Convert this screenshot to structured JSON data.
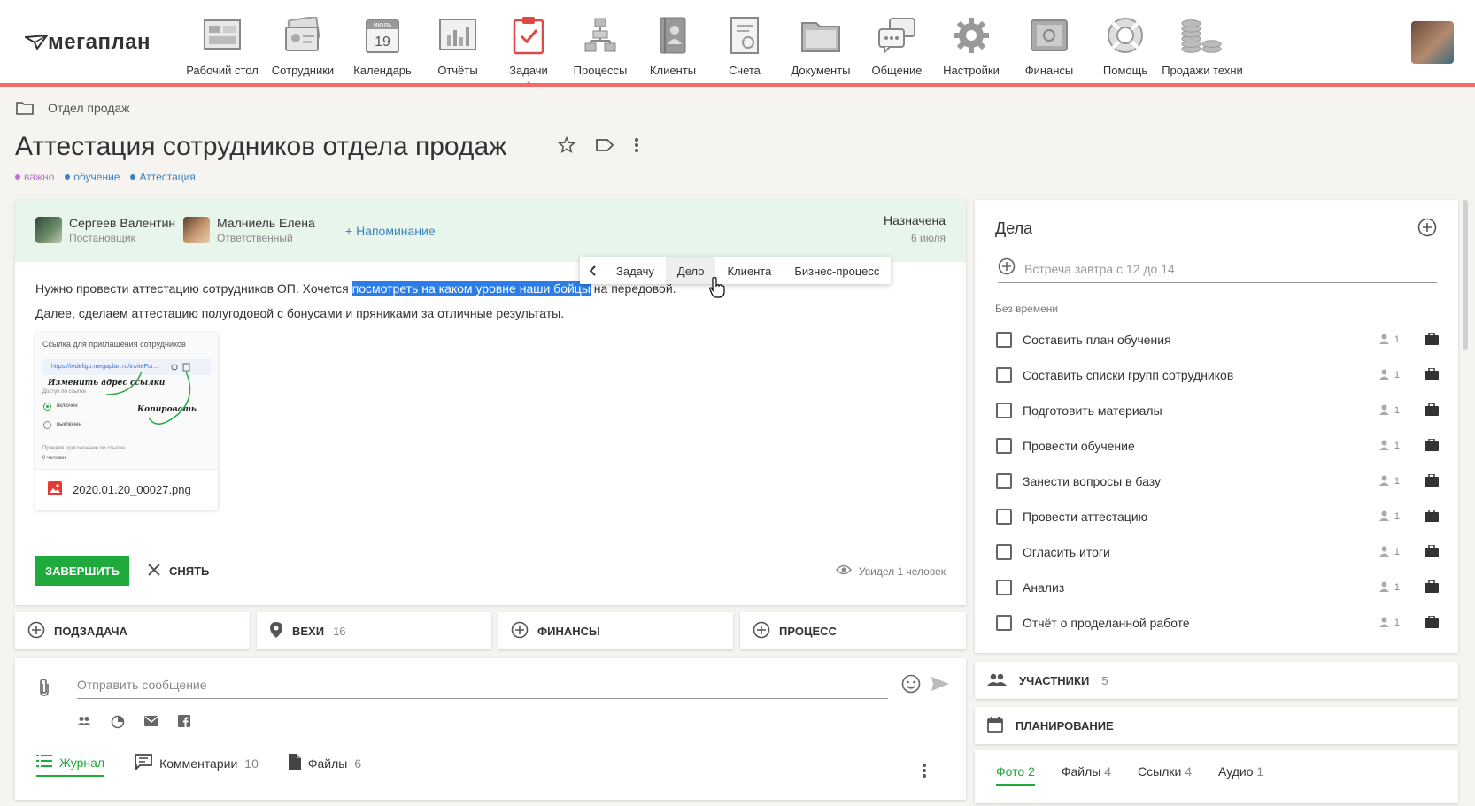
{
  "app": {
    "logo_text": "мегаплан"
  },
  "nav": [
    {
      "label": "Рабочий стол",
      "icon": "desktop-icon"
    },
    {
      "label": "Сотрудники",
      "icon": "employees-icon"
    },
    {
      "label": "Календарь",
      "icon": "calendar-icon",
      "cal_month": "ИЮЛЬ",
      "cal_day": "19"
    },
    {
      "label": "Отчёты",
      "icon": "reports-icon"
    },
    {
      "label": "Задачи",
      "icon": "tasks-icon",
      "active": true
    },
    {
      "label": "Процессы",
      "icon": "processes-icon"
    },
    {
      "label": "Клиенты",
      "icon": "clients-icon"
    },
    {
      "label": "Счета",
      "icon": "invoices-icon"
    },
    {
      "label": "Документы",
      "icon": "documents-icon"
    },
    {
      "label": "Общение",
      "icon": "chat-icon"
    },
    {
      "label": "Настройки",
      "icon": "settings-icon"
    },
    {
      "label": "Финансы",
      "icon": "finance-icon"
    },
    {
      "label": "Помощь",
      "icon": "help-icon"
    },
    {
      "label": "Продажи техни",
      "icon": "sales-icon"
    }
  ],
  "breadcrumb": {
    "folder": "Отдел продаж"
  },
  "task": {
    "title": "Аттестация сотрудников отдела продаж",
    "tags": [
      {
        "label": "важно",
        "color": "#c070d8"
      },
      {
        "label": "обучение",
        "color": "#3b82c4"
      },
      {
        "label": "Аттестация",
        "color": "#3b82c4"
      }
    ],
    "owner": {
      "name": "Сергеев Валентин",
      "role": "Постановщик"
    },
    "responsible": {
      "name": "Малниель Елена",
      "role": "Ответственный"
    },
    "reminder_label": "+ Напоминание",
    "status": "Назначена",
    "status_date": "6 июля",
    "desc_line1_a": "Нужно провести аттестацию сотрудников ОП. Хочется ",
    "desc_line1_hl": "посмотреть на каком уровне наши бойцы",
    "desc_line1_b": " на передовой.",
    "desc_line2": "Далее, сделаем аттестацию полугодовой с бонусами и пряниками за отличные результаты.",
    "popup": [
      "Задачу",
      "Дело",
      "Клиента",
      "Бизнес-процесс"
    ],
    "attachment": {
      "filename": "2020.01.20_00027.png",
      "thumb_title": "Ссылка для приглашения сотрудников",
      "thumb_link": "https://tedeligo.megaplan.ru/inviteFor...",
      "thumb_note1": "Изменить адрес ссылки",
      "thumb_note2": "Копировать",
      "thumb_access": "Доступ по ссылке",
      "thumb_on": "включен",
      "thumb_off": "выключен",
      "thumb_accepted": "Приняли приглашение по ссылке",
      "thumb_count": "0 человек"
    },
    "finish_label": "ЗАВЕРШИТЬ",
    "remove_label": "СНЯТЬ",
    "seen_label": "Увидел 1 человек"
  },
  "quick_actions": [
    {
      "label": "ПОДЗАДАЧА",
      "count": ""
    },
    {
      "label": "ВЕХИ",
      "count": "16"
    },
    {
      "label": "ФИНАНСЫ",
      "count": ""
    },
    {
      "label": "ПРОЦЕСС",
      "count": ""
    }
  ],
  "message": {
    "placeholder": "Отправить сообщение",
    "tabs": [
      {
        "label": "Журнал",
        "count": ""
      },
      {
        "label": "Комментарии",
        "count": "10"
      },
      {
        "label": "Файлы",
        "count": "6"
      }
    ]
  },
  "deals": {
    "title": "Дела",
    "input_placeholder": "Встреча завтра с 12 до 14",
    "section_label": "Без времени",
    "items": [
      {
        "label": "Составить план обучения",
        "count": "1"
      },
      {
        "label": "Составить списки групп сотрудников",
        "count": "1"
      },
      {
        "label": "Подготовить материалы",
        "count": "1"
      },
      {
        "label": "Провести обучение",
        "count": "1"
      },
      {
        "label": "Занести вопросы в базу",
        "count": "1"
      },
      {
        "label": "Провести аттестацию",
        "count": "1"
      },
      {
        "label": "Огласить итоги",
        "count": "1"
      },
      {
        "label": "Анализ",
        "count": "1"
      },
      {
        "label": "Отчёт о проделанной работе",
        "count": "1"
      }
    ]
  },
  "participants": {
    "label": "УЧАСТНИКИ",
    "count": "5"
  },
  "planning": {
    "label": "ПЛАНИРОВАНИЕ"
  },
  "media_tabs": [
    {
      "label": "Фото",
      "count": "2"
    },
    {
      "label": "Файлы",
      "count": "4"
    },
    {
      "label": "Ссылки",
      "count": "4"
    },
    {
      "label": "Аудио",
      "count": "1"
    }
  ],
  "colors": {
    "accent": "#1faa3c",
    "nav_line": "#f26b6b",
    "link": "#3b82c4",
    "selection": "#2b7de9"
  }
}
